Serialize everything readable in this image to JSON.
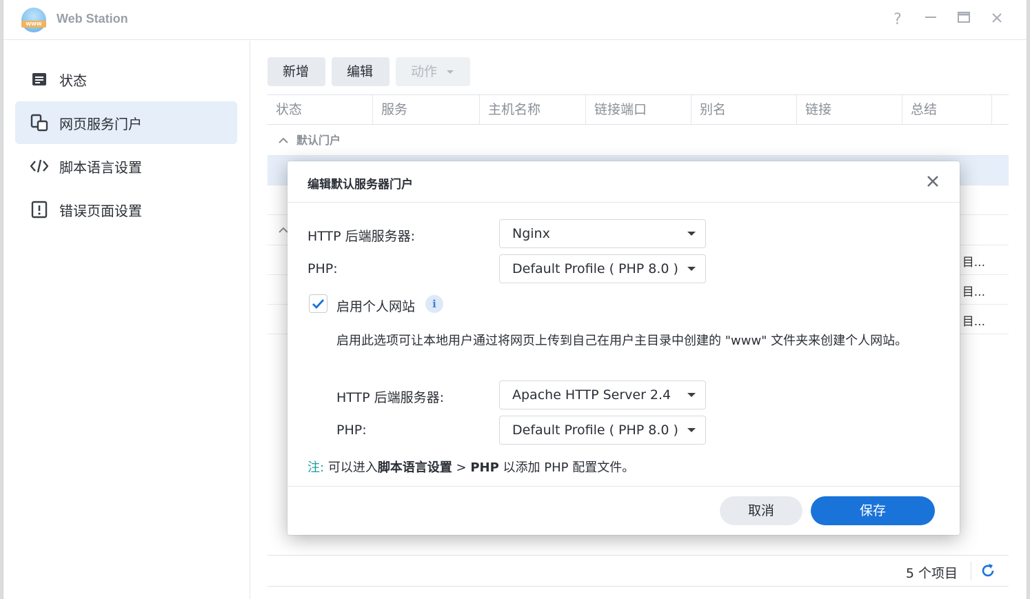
{
  "app": {
    "title": "Web Station"
  },
  "window_controls": {
    "help": "?",
    "minimize": "—",
    "maximize": "□",
    "close": "✕"
  },
  "sidebar": {
    "items": [
      {
        "label": "状态",
        "icon": "status-icon",
        "active": false
      },
      {
        "label": "网页服务门户",
        "icon": "portal-icon",
        "active": true
      },
      {
        "label": "脚本语言设置",
        "icon": "code-icon",
        "active": false
      },
      {
        "label": "错误页面设置",
        "icon": "error-page-icon",
        "active": false
      }
    ]
  },
  "toolbar": {
    "add": "新增",
    "edit": "编辑",
    "action": "动作"
  },
  "grid": {
    "columns": [
      "状态",
      "服务",
      "主机名称",
      "链接端口",
      "别名",
      "链接",
      "总结"
    ],
    "group_default": "默认门户",
    "row_tails": [
      "目...",
      "目...",
      "目..."
    ],
    "footer_count": "5 个项目"
  },
  "dialog": {
    "title": "编辑默认服务器门户",
    "http_backend_label": "HTTP 后端服务器:",
    "http_backend_value": "Nginx",
    "php_label": "PHP:",
    "php_value": "Default Profile ( PHP 8.0 )",
    "enable_personal_label": "启用个人网站",
    "enable_personal_checked": true,
    "personal_desc": "启用此选项可让本地用户通过将网页上传到自己在用户主目录中创建的 \"www\" 文件夹来创建个人网站。",
    "personal_http_label": "HTTP 后端服务器:",
    "personal_http_value": "Apache HTTP Server 2.4",
    "personal_php_label": "PHP:",
    "personal_php_value": "Default Profile ( PHP 8.0 )",
    "note_prefix": "注:",
    "note_text_1": "可以进入",
    "note_bold_1": "脚本语言设置",
    "note_arrow": " > ",
    "note_bold_2": "PHP",
    "note_text_2": " 以添加 PHP 配置文件。",
    "cancel": "取消",
    "save": "保存"
  },
  "colors": {
    "accent": "#1a73d9",
    "selected_bg": "#e5eef9",
    "note_teal": "#1a9e9e"
  }
}
